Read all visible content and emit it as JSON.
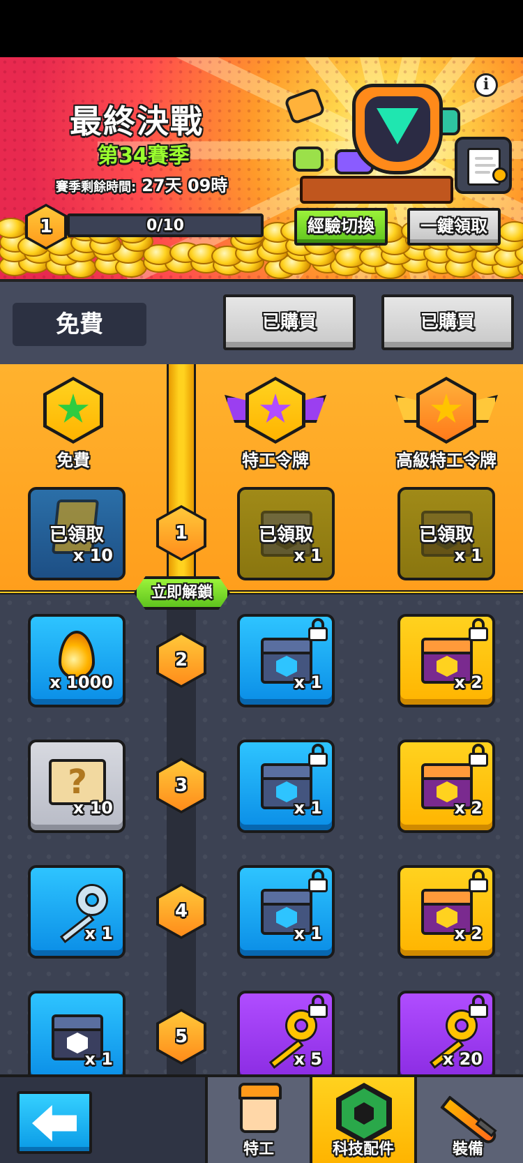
{
  "header": {
    "title": "最終決戰",
    "season": "第34賽季",
    "time_label": "賽季剩餘時間:",
    "time_value": "27天 09時",
    "info_icon": "info-icon",
    "level": "1",
    "xp_progress": "0/10",
    "exp_switch_label": "經驗切換",
    "claim_all_label": "一鍵領取"
  },
  "tabs": {
    "free": "免費",
    "bought_1": "已購買",
    "bought_2": "已購買"
  },
  "columns": {
    "free": "免費",
    "agent_pass": "特工令牌",
    "premium_pass": "高級特工令牌"
  },
  "rows": [
    {
      "level": "1",
      "free": {
        "icon": "scroll-icon",
        "qty": "x 10",
        "claimed": "已領取"
      },
      "agent": {
        "icon": "chest-icon",
        "qty": "x 1",
        "claimed": "已領取"
      },
      "premium": {
        "icon": "chest-icon",
        "qty": "x 1",
        "claimed": "已領取"
      }
    },
    {
      "level": "2",
      "free": {
        "icon": "fuel-drop-icon",
        "qty": "x 1000"
      },
      "agent": {
        "icon": "chest-icon",
        "qty": "x 1"
      },
      "premium": {
        "icon": "chest-icon",
        "qty": "x 2"
      }
    },
    {
      "level": "3",
      "free": {
        "icon": "mystery-map-icon",
        "qty": "x 10"
      },
      "agent": {
        "icon": "chest-icon",
        "qty": "x 1"
      },
      "premium": {
        "icon": "chest-icon",
        "qty": "x 2"
      }
    },
    {
      "level": "4",
      "free": {
        "icon": "key-icon",
        "qty": "x 1"
      },
      "agent": {
        "icon": "chest-icon",
        "qty": "x 1"
      },
      "premium": {
        "icon": "chest-icon",
        "qty": "x 2"
      }
    },
    {
      "level": "5",
      "free": {
        "icon": "chest-icon",
        "qty": "x 1"
      },
      "agent": {
        "icon": "gold-key-icon",
        "qty": "x 5"
      },
      "premium": {
        "icon": "gold-key-icon",
        "qty": "x 20"
      }
    }
  ],
  "unlock_label": "立即解鎖",
  "nav": {
    "agent": "特工",
    "tech": "科技配件",
    "gear": "裝備",
    "back_icon": "back-arrow-icon"
  },
  "colors": {
    "accent_yellow": "#ffd21f",
    "accent_green": "#6fd42a",
    "slot_blue": "#1aa3f0",
    "slot_purple": "#9b3ff0"
  }
}
